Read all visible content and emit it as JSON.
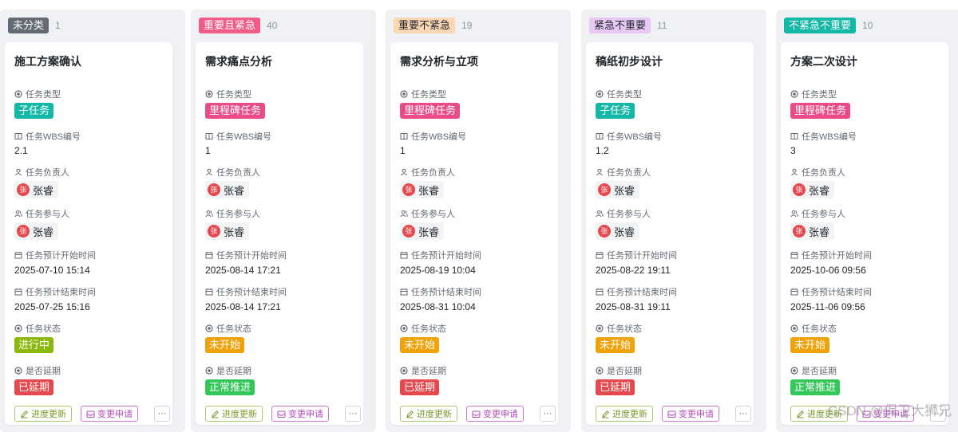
{
  "labels": {
    "type": "任务类型",
    "wbs": "任务WBS编号",
    "owner": "任务负责人",
    "participant": "任务参与人",
    "start": "任务预计开始时间",
    "end": "任务预计结束时间",
    "status": "任务状态",
    "delayed": "是否延期"
  },
  "buttons": {
    "progress": "进度更新",
    "change": "变更申请",
    "more": "···"
  },
  "avatar_char": "张",
  "columns": [
    {
      "tag": "未分类",
      "count": "1",
      "tag_bg": "#646a73",
      "tag_fg": "#ffffff",
      "card": {
        "title": "施工方案确认",
        "type": "子任务",
        "type_color": "#14b8a6",
        "wbs": "2.1",
        "owner": "张睿",
        "participant": "张睿",
        "start": "2025-07-10 15:14",
        "end": "2025-07-25 15:16",
        "status": "进行中",
        "status_color": "#8ab80b",
        "delayed": "已延期",
        "delayed_color": "#e5484d"
      }
    },
    {
      "tag": "重要且紧急",
      "count": "40",
      "tag_bg": "#f25b85",
      "tag_fg": "#ffffff",
      "card": {
        "title": "需求痛点分析",
        "type": "里程碑任务",
        "type_color": "#ea4c89",
        "wbs": "1",
        "owner": "张睿",
        "participant": "张睿",
        "start": "2025-08-14 17:21",
        "end": "2025-08-14 17:21",
        "status": "未开始",
        "status_color": "#f0a20b",
        "delayed": "正常推进",
        "delayed_color": "#34c759"
      }
    },
    {
      "tag": "重要不紧急",
      "count": "19",
      "tag_bg": "#fcd7b4",
      "tag_fg": "#1f2329",
      "card": {
        "title": "需求分析与立项",
        "type": "里程碑任务",
        "type_color": "#ea4c89",
        "wbs": "1",
        "owner": "张睿",
        "participant": "张睿",
        "start": "2025-08-19 10:04",
        "end": "2025-08-31 10:04",
        "status": "未开始",
        "status_color": "#f0a20b",
        "delayed": "已延期",
        "delayed_color": "#e5484d"
      }
    },
    {
      "tag": "紧急不重要",
      "count": "11",
      "tag_bg": "#e8c8f4",
      "tag_fg": "#1f2329",
      "card": {
        "title": "稿纸初步设计",
        "type": "子任务",
        "type_color": "#14b8a6",
        "wbs": "1.2",
        "owner": "张睿",
        "participant": "张睿",
        "start": "2025-08-22 19:11",
        "end": "2025-08-31 19:11",
        "status": "未开始",
        "status_color": "#f0a20b",
        "delayed": "已延期",
        "delayed_color": "#e5484d"
      }
    },
    {
      "tag": "不紧急不重要",
      "count": "10",
      "tag_bg": "#14b8a6",
      "tag_fg": "#ffffff",
      "card": {
        "title": "方案二次设计",
        "type": "里程碑任务",
        "type_color": "#ea4c89",
        "wbs": "3",
        "owner": "张睿",
        "participant": "张睿",
        "start": "2025-10-06 09:56",
        "end": "2025-11-06 09:56",
        "status": "未开始",
        "status_color": "#f0a20b",
        "delayed": "正常推进",
        "delayed_color": "#34c759"
      }
    }
  ],
  "watermark": "CSDN @保卫大狮兄"
}
